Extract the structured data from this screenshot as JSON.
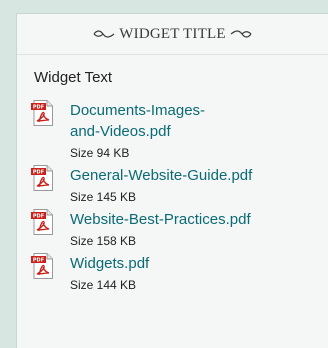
{
  "widget": {
    "title": "WIDGET TITLE",
    "text": "Widget Text"
  },
  "files": [
    {
      "name": "Documents-Images-\nand-Videos.pdf",
      "size": "Size 94 KB",
      "icon": "pdf-icon"
    },
    {
      "name": "General-Website-Guide.pdf",
      "size": "Size 145 KB",
      "icon": "pdf-icon"
    },
    {
      "name": "Website-Best-Practices.pdf",
      "size": "Size 158 KB",
      "icon": "pdf-icon"
    },
    {
      "name": "Widgets.pdf",
      "size": "Size 144 KB",
      "icon": "pdf-icon"
    }
  ],
  "colors": {
    "link": "#0b6b75",
    "page_bg": "#d8e6e1",
    "widget_bg": "#f5f6f6",
    "pdf_red": "#c8221b"
  }
}
